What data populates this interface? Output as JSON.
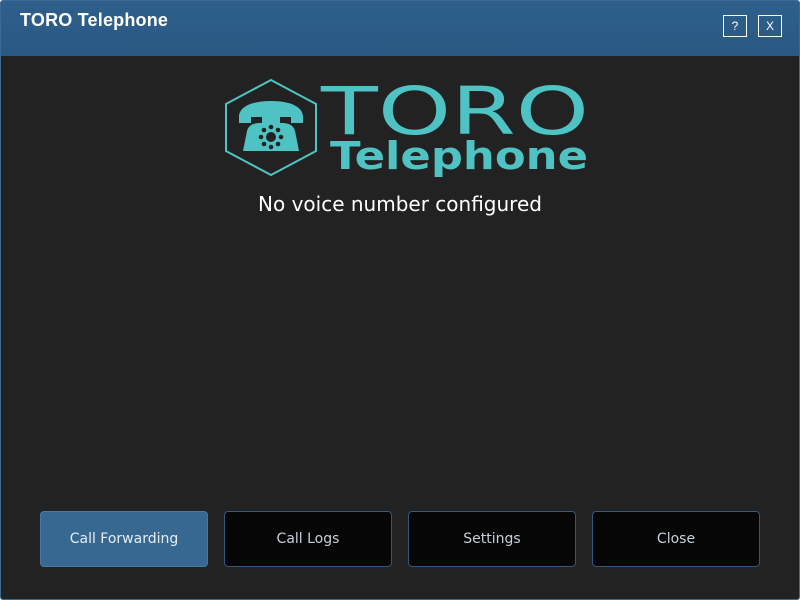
{
  "window": {
    "title": "TORO Telephone",
    "help_label": "?",
    "close_label": "X"
  },
  "logo": {
    "line1": "TORO",
    "line2": "Telephone",
    "color": "#4fc3c3"
  },
  "status": {
    "message": "No voice number configured"
  },
  "buttons": {
    "call_forwarding": "Call Forwarding",
    "call_logs": "Call Logs",
    "settings": "Settings",
    "close": "Close"
  },
  "colors": {
    "titlebar": "#2e5f8c",
    "background": "#222222",
    "primary_button": "#376891",
    "button": "#060606"
  }
}
